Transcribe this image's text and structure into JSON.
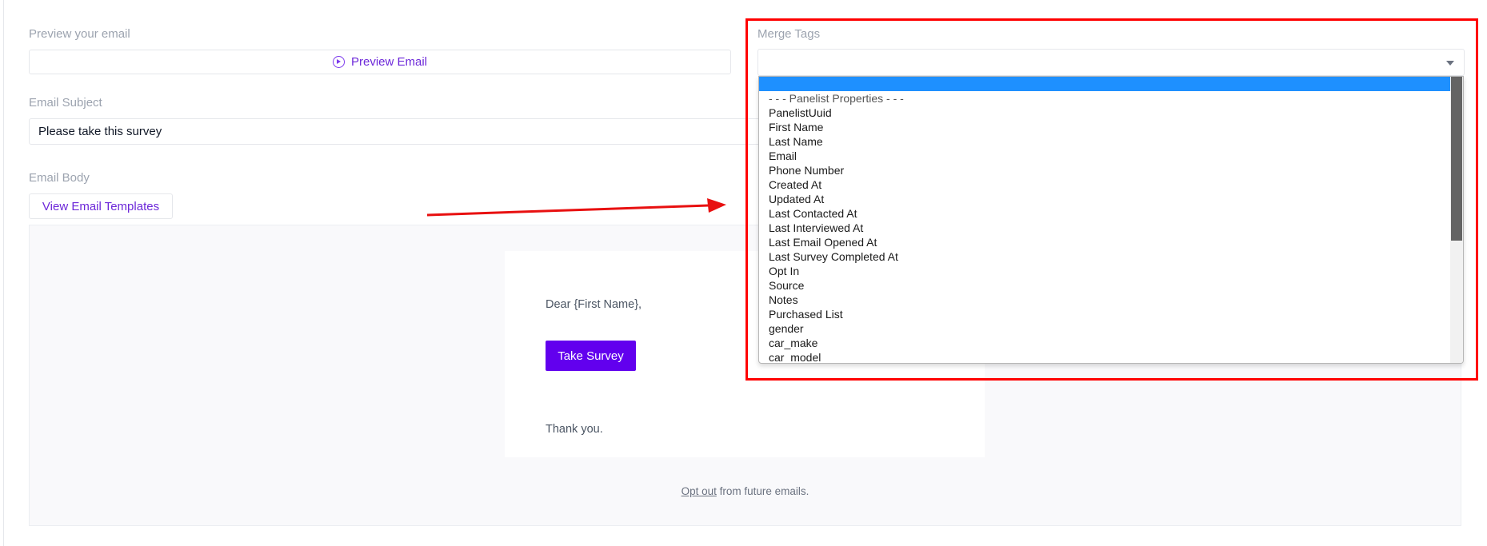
{
  "preview": {
    "label": "Preview your email",
    "button_label": "Preview Email"
  },
  "subject": {
    "label": "Email Subject",
    "value": "Please take this survey"
  },
  "body": {
    "label": "Email Body",
    "templates_button": "View Email Templates",
    "greeting": "Dear {First Name},",
    "survey_button": "Take Survey",
    "thanks": "Thank you.",
    "optout_link": "Opt out",
    "optout_rest": " from future emails."
  },
  "merge_tags": {
    "label": "Merge Tags",
    "selected_value": "",
    "options": [
      "- - - Panelist Properties - - -",
      "PanelistUuid",
      "First Name",
      "Last Name",
      "Email",
      "Phone Number",
      "Created At",
      "Updated At",
      "Last Contacted At",
      "Last Interviewed At",
      "Last Email Opened At",
      "Last Survey Completed At",
      "Opt In",
      "Source",
      "Notes",
      "Purchased List",
      "gender",
      "car_make",
      "car_model"
    ]
  },
  "colors": {
    "accent": "#6200ee",
    "link": "#6d28d9",
    "highlight": "#ff0000",
    "dropdown_selected": "#1e90ff"
  }
}
